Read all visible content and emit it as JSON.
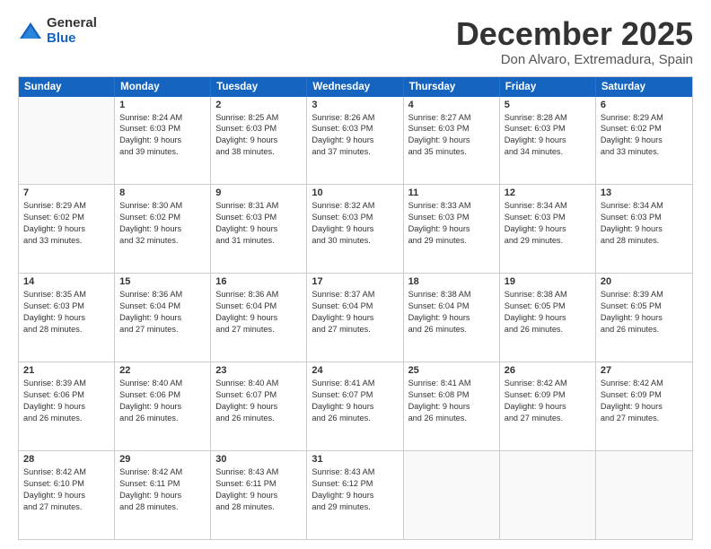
{
  "logo": {
    "general": "General",
    "blue": "Blue"
  },
  "header": {
    "month": "December 2025",
    "location": "Don Alvaro, Extremadura, Spain"
  },
  "weekdays": [
    "Sunday",
    "Monday",
    "Tuesday",
    "Wednesday",
    "Thursday",
    "Friday",
    "Saturday"
  ],
  "rows": [
    [
      {
        "day": "",
        "empty": true,
        "lines": []
      },
      {
        "day": "1",
        "empty": false,
        "lines": [
          "Sunrise: 8:24 AM",
          "Sunset: 6:03 PM",
          "Daylight: 9 hours",
          "and 39 minutes."
        ]
      },
      {
        "day": "2",
        "empty": false,
        "lines": [
          "Sunrise: 8:25 AM",
          "Sunset: 6:03 PM",
          "Daylight: 9 hours",
          "and 38 minutes."
        ]
      },
      {
        "day": "3",
        "empty": false,
        "lines": [
          "Sunrise: 8:26 AM",
          "Sunset: 6:03 PM",
          "Daylight: 9 hours",
          "and 37 minutes."
        ]
      },
      {
        "day": "4",
        "empty": false,
        "lines": [
          "Sunrise: 8:27 AM",
          "Sunset: 6:03 PM",
          "Daylight: 9 hours",
          "and 35 minutes."
        ]
      },
      {
        "day": "5",
        "empty": false,
        "lines": [
          "Sunrise: 8:28 AM",
          "Sunset: 6:03 PM",
          "Daylight: 9 hours",
          "and 34 minutes."
        ]
      },
      {
        "day": "6",
        "empty": false,
        "lines": [
          "Sunrise: 8:29 AM",
          "Sunset: 6:02 PM",
          "Daylight: 9 hours",
          "and 33 minutes."
        ]
      }
    ],
    [
      {
        "day": "7",
        "empty": false,
        "lines": [
          "Sunrise: 8:29 AM",
          "Sunset: 6:02 PM",
          "Daylight: 9 hours",
          "and 33 minutes."
        ]
      },
      {
        "day": "8",
        "empty": false,
        "lines": [
          "Sunrise: 8:30 AM",
          "Sunset: 6:02 PM",
          "Daylight: 9 hours",
          "and 32 minutes."
        ]
      },
      {
        "day": "9",
        "empty": false,
        "lines": [
          "Sunrise: 8:31 AM",
          "Sunset: 6:03 PM",
          "Daylight: 9 hours",
          "and 31 minutes."
        ]
      },
      {
        "day": "10",
        "empty": false,
        "lines": [
          "Sunrise: 8:32 AM",
          "Sunset: 6:03 PM",
          "Daylight: 9 hours",
          "and 30 minutes."
        ]
      },
      {
        "day": "11",
        "empty": false,
        "lines": [
          "Sunrise: 8:33 AM",
          "Sunset: 6:03 PM",
          "Daylight: 9 hours",
          "and 29 minutes."
        ]
      },
      {
        "day": "12",
        "empty": false,
        "lines": [
          "Sunrise: 8:34 AM",
          "Sunset: 6:03 PM",
          "Daylight: 9 hours",
          "and 29 minutes."
        ]
      },
      {
        "day": "13",
        "empty": false,
        "lines": [
          "Sunrise: 8:34 AM",
          "Sunset: 6:03 PM",
          "Daylight: 9 hours",
          "and 28 minutes."
        ]
      }
    ],
    [
      {
        "day": "14",
        "empty": false,
        "lines": [
          "Sunrise: 8:35 AM",
          "Sunset: 6:03 PM",
          "Daylight: 9 hours",
          "and 28 minutes."
        ]
      },
      {
        "day": "15",
        "empty": false,
        "lines": [
          "Sunrise: 8:36 AM",
          "Sunset: 6:04 PM",
          "Daylight: 9 hours",
          "and 27 minutes."
        ]
      },
      {
        "day": "16",
        "empty": false,
        "lines": [
          "Sunrise: 8:36 AM",
          "Sunset: 6:04 PM",
          "Daylight: 9 hours",
          "and 27 minutes."
        ]
      },
      {
        "day": "17",
        "empty": false,
        "lines": [
          "Sunrise: 8:37 AM",
          "Sunset: 6:04 PM",
          "Daylight: 9 hours",
          "and 27 minutes."
        ]
      },
      {
        "day": "18",
        "empty": false,
        "lines": [
          "Sunrise: 8:38 AM",
          "Sunset: 6:04 PM",
          "Daylight: 9 hours",
          "and 26 minutes."
        ]
      },
      {
        "day": "19",
        "empty": false,
        "lines": [
          "Sunrise: 8:38 AM",
          "Sunset: 6:05 PM",
          "Daylight: 9 hours",
          "and 26 minutes."
        ]
      },
      {
        "day": "20",
        "empty": false,
        "lines": [
          "Sunrise: 8:39 AM",
          "Sunset: 6:05 PM",
          "Daylight: 9 hours",
          "and 26 minutes."
        ]
      }
    ],
    [
      {
        "day": "21",
        "empty": false,
        "lines": [
          "Sunrise: 8:39 AM",
          "Sunset: 6:06 PM",
          "Daylight: 9 hours",
          "and 26 minutes."
        ]
      },
      {
        "day": "22",
        "empty": false,
        "lines": [
          "Sunrise: 8:40 AM",
          "Sunset: 6:06 PM",
          "Daylight: 9 hours",
          "and 26 minutes."
        ]
      },
      {
        "day": "23",
        "empty": false,
        "lines": [
          "Sunrise: 8:40 AM",
          "Sunset: 6:07 PM",
          "Daylight: 9 hours",
          "and 26 minutes."
        ]
      },
      {
        "day": "24",
        "empty": false,
        "lines": [
          "Sunrise: 8:41 AM",
          "Sunset: 6:07 PM",
          "Daylight: 9 hours",
          "and 26 minutes."
        ]
      },
      {
        "day": "25",
        "empty": false,
        "lines": [
          "Sunrise: 8:41 AM",
          "Sunset: 6:08 PM",
          "Daylight: 9 hours",
          "and 26 minutes."
        ]
      },
      {
        "day": "26",
        "empty": false,
        "lines": [
          "Sunrise: 8:42 AM",
          "Sunset: 6:09 PM",
          "Daylight: 9 hours",
          "and 27 minutes."
        ]
      },
      {
        "day": "27",
        "empty": false,
        "lines": [
          "Sunrise: 8:42 AM",
          "Sunset: 6:09 PM",
          "Daylight: 9 hours",
          "and 27 minutes."
        ]
      }
    ],
    [
      {
        "day": "28",
        "empty": false,
        "lines": [
          "Sunrise: 8:42 AM",
          "Sunset: 6:10 PM",
          "Daylight: 9 hours",
          "and 27 minutes."
        ]
      },
      {
        "day": "29",
        "empty": false,
        "lines": [
          "Sunrise: 8:42 AM",
          "Sunset: 6:11 PM",
          "Daylight: 9 hours",
          "and 28 minutes."
        ]
      },
      {
        "day": "30",
        "empty": false,
        "lines": [
          "Sunrise: 8:43 AM",
          "Sunset: 6:11 PM",
          "Daylight: 9 hours",
          "and 28 minutes."
        ]
      },
      {
        "day": "31",
        "empty": false,
        "lines": [
          "Sunrise: 8:43 AM",
          "Sunset: 6:12 PM",
          "Daylight: 9 hours",
          "and 29 minutes."
        ]
      },
      {
        "day": "",
        "empty": true,
        "lines": []
      },
      {
        "day": "",
        "empty": true,
        "lines": []
      },
      {
        "day": "",
        "empty": true,
        "lines": []
      }
    ]
  ]
}
